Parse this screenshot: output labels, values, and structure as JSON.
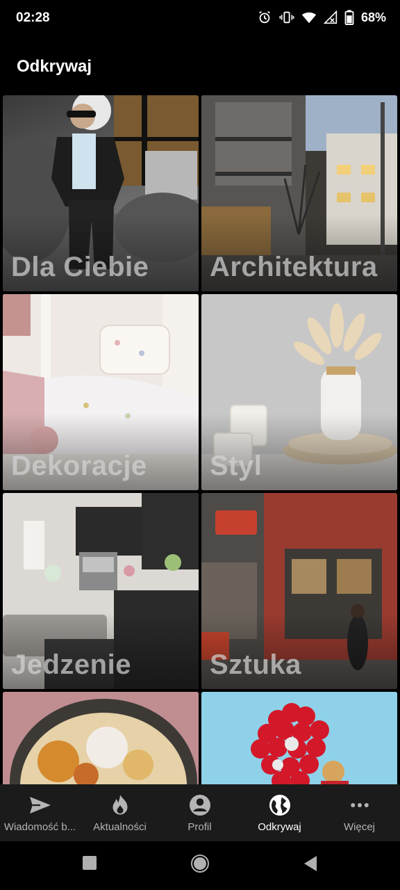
{
  "status_bar": {
    "time": "02:28",
    "battery": "68%",
    "icons": [
      "alarm-icon",
      "vibrate-icon",
      "wifi-icon",
      "signal-icon",
      "battery-icon"
    ]
  },
  "header": {
    "title": "Odkrywaj"
  },
  "categories": [
    {
      "label": "Dla Ciebie"
    },
    {
      "label": "Architektura"
    },
    {
      "label": "Dekoracje"
    },
    {
      "label": "Styl"
    },
    {
      "label": "Jedzenie"
    },
    {
      "label": "Sztuka"
    },
    {
      "label": ""
    },
    {
      "label": ""
    }
  ],
  "bottom_nav": {
    "items": [
      {
        "label": "Wiadomość b...",
        "icon": "send-icon",
        "active": false
      },
      {
        "label": "Aktualności",
        "icon": "flame-icon",
        "active": false
      },
      {
        "label": "Profil",
        "icon": "profile-icon",
        "active": false
      },
      {
        "label": "Odkrywaj",
        "icon": "globe-icon",
        "active": true
      },
      {
        "label": "Więcej",
        "icon": "more-icon",
        "active": false
      }
    ]
  },
  "system_nav": [
    "recents-button",
    "home-button",
    "back-button"
  ],
  "colors": {
    "background": "#000000",
    "nav_background": "#1b1b1b",
    "active": "#ffffff",
    "inactive": "#b4b4b4"
  }
}
